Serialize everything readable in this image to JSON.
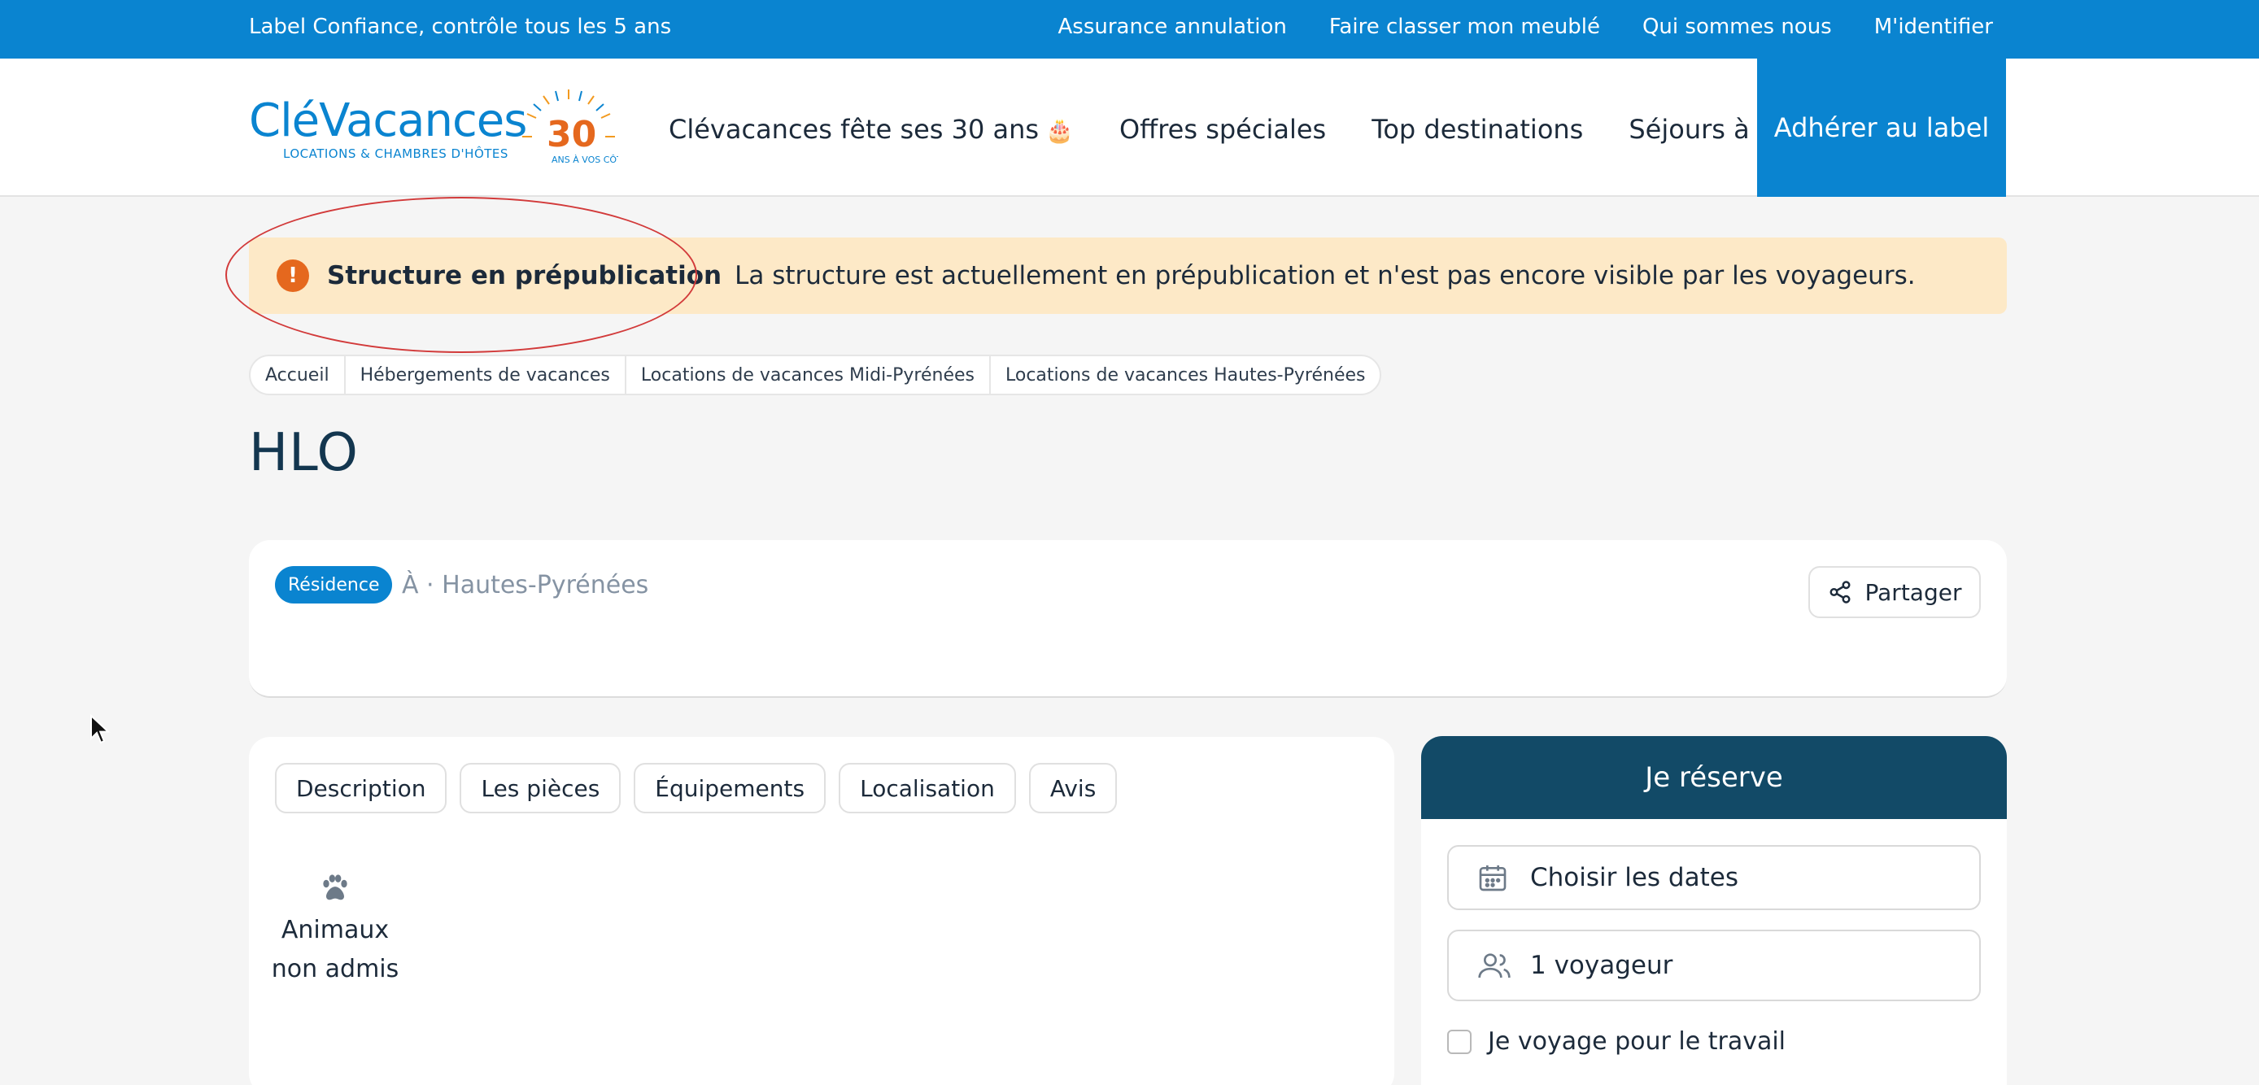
{
  "topbar": {
    "tagline": "Label Confiance, contrôle tous les 5 ans",
    "links": [
      "Assurance annulation",
      "Faire classer mon meublé",
      "Qui sommes nous",
      "M'identifier"
    ]
  },
  "header": {
    "logo_text": "CléVacances",
    "logo_sub": "LOCATIONS & CHAMBRES D'HÔTES",
    "badge_number": "30",
    "badge_text": "ANS À VOS CÔTÉS",
    "nav": [
      "Clévacances fête ses 30 ans",
      "Offres spéciales",
      "Top destinations",
      "Séjours à thèmes"
    ],
    "nav_emoji": "🎂",
    "cta": "Adhérer au label"
  },
  "alert": {
    "icon": "!",
    "title": "Structure en prépublication",
    "message": "La structure est actuellement en prépublication et n'est pas encore visible par les voyageurs."
  },
  "breadcrumb": [
    "Accueil",
    "Hébergements de vacances",
    "Locations de vacances Midi-Pyrénées",
    "Locations de vacances Hautes-Pyrénées"
  ],
  "page_title": "HLO",
  "property": {
    "type": "Résidence",
    "location": "À · Hautes-Pyrénées",
    "share": "Partager"
  },
  "tabs": [
    "Description",
    "Les pièces",
    "Équipements",
    "Localisation",
    "Avis"
  ],
  "feature": {
    "icon": "paw-icon",
    "label": "Animaux non admis"
  },
  "booking": {
    "title": "Je réserve",
    "dates": "Choisir les dates",
    "travelers": "1 voyageur",
    "business": "Je voyage pour le travail"
  },
  "colors": {
    "primary": "#0a84d0",
    "dark": "#124a67",
    "alert_bg": "#fde9c7",
    "alert_icon": "#e5681e"
  }
}
